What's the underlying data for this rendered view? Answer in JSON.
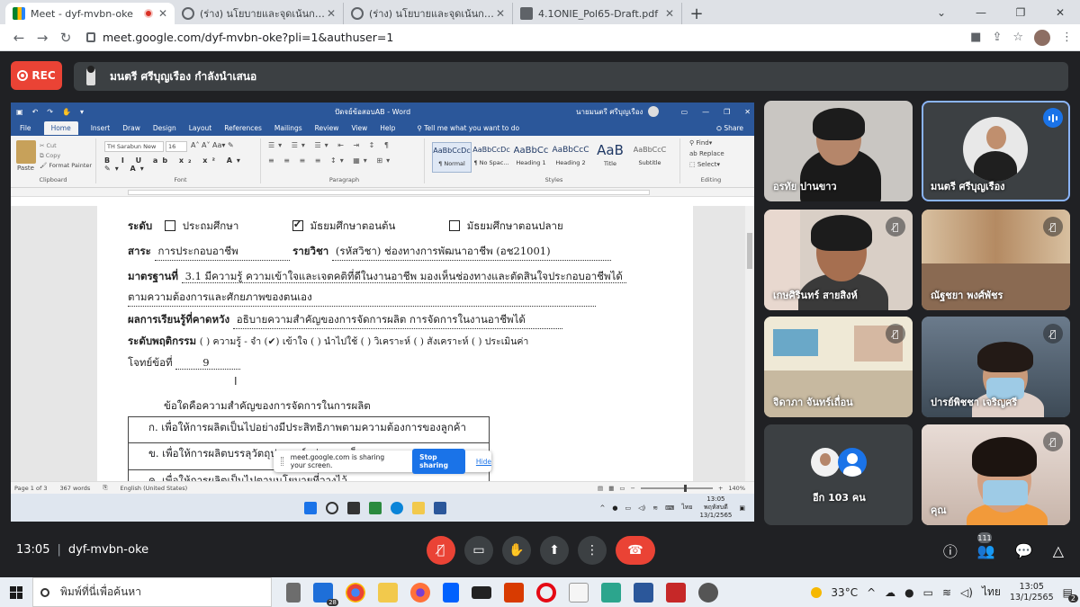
{
  "browser": {
    "tabs": [
      {
        "title": "Meet - dyf-mvbn-oke",
        "icon": "meet-icon",
        "active": true,
        "recording": true
      },
      {
        "title": "(ร่าง) นโยบายและจุดเน้นการดำเนินงาน",
        "icon": "globe-icon"
      },
      {
        "title": "(ร่าง) นโยบายและจุดเน้นการดำเนินงาน",
        "icon": "globe-icon"
      },
      {
        "title": "4.1ONIE_Pol65-Draft.pdf",
        "icon": "pdf-icon"
      }
    ],
    "url": "meet.google.com/dyf-mvbn-oke?pli=1&authuser=1"
  },
  "meet": {
    "rec_label": "REC",
    "presenting_text": "มนตรี ศรีบุญเรือง กำลังนำเสนอ",
    "time": "13:05",
    "meeting_code": "dyf-mvbn-oke",
    "people_count": "111",
    "colors": {
      "bg": "#202124",
      "tile": "#3c4043",
      "red": "#ea4335",
      "blue": "#1a73e8"
    }
  },
  "word": {
    "title": "ปัดจย์ข้อสอบAB - Word",
    "user": "นายมนตรี ศรีบุญเรือง",
    "menu": [
      "File",
      "Home",
      "Insert",
      "Draw",
      "Design",
      "Layout",
      "References",
      "Mailings",
      "Review",
      "View",
      "Help"
    ],
    "tell_me": "Tell me what you want to do",
    "share": "Share",
    "clipboard": {
      "paste": "Paste",
      "cut": "Cut",
      "copy": "Copy",
      "painter": "Format Painter",
      "label": "Clipboard"
    },
    "font": {
      "name": "TH Sarabun New",
      "size": "16",
      "label": "Font"
    },
    "paragraph_label": "Paragraph",
    "styles": [
      {
        "preview": "AaBbCcDc",
        "name": "¶ Normal"
      },
      {
        "preview": "AaBbCcDc",
        "name": "¶ No Spac..."
      },
      {
        "preview": "AaBbCc",
        "name": "Heading 1"
      },
      {
        "preview": "AaBbCcC",
        "name": "Heading 2"
      },
      {
        "preview": "AaB",
        "name": "Title"
      },
      {
        "preview": "AaBbCcC",
        "name": "Subtitle"
      }
    ],
    "styles_label": "Styles",
    "editing": {
      "find": "Find",
      "replace": "Replace",
      "select": "Select",
      "label": "Editing"
    },
    "status": {
      "page": "Page 1 of 3",
      "words": "367 words",
      "lang": "English (United States)",
      "zoom": "140%"
    },
    "toast": {
      "text": "meet.google.com is sharing your screen.",
      "stop": "Stop sharing",
      "hide": "Hide"
    },
    "taskbar_time": "13:05",
    "taskbar_day": "พฤหัสบดี",
    "taskbar_date": "13/1/2565",
    "taskbar_lang": "ไทย"
  },
  "doc": {
    "level_label": "ระดับ",
    "level_options": [
      {
        "label": "ประถมศึกษา",
        "checked": false
      },
      {
        "label": "มัธยมศึกษาตอนต้น",
        "checked": true
      },
      {
        "label": "มัธยมศึกษาตอนปลาย",
        "checked": false
      }
    ],
    "strand_label": "สาระ",
    "strand_value": "การประกอบอาชีพ",
    "subject_label": "รายวิชา",
    "subject_value": "(รหัสวิชา)  ช่องทางการพัฒนาอาชีพ (อช21001)",
    "standard_label": "มาตรฐานที่",
    "standard_value": "3.1 มีความรู้ ความเข้าใจและเจตคติที่ดีในงานอาชีพ มองเห็นช่องทางและตัดสินใจประกอบอาชีพได้",
    "standard_value2": "ตามความต้องการและศักยภาพของตนเอง",
    "outcome_label": "ผลการเรียนรู้ที่คาดหวัง",
    "outcome_value": "อธิบายความสำคัญของการจัดการผลิต การจัดการในงานอาชีพได้",
    "behavior_label": "ระดับพฤติกรรม",
    "behavior_value": "(   ) ความรู้ - จำ  (✔) เข้าใจ    (   ) นำไปใช้    (   ) วิเคราะห์  (   ) สังเคราะห์ (   ) ประเมินค่า",
    "item_label": "โจทย์ข้อที่",
    "item_value": "9",
    "question": "ข้อใดคือความสำคัญของการจัดการในการผลิต",
    "choices": [
      "ก. เพื่อให้การผลิตเป็นไปอย่างมีประสิทธิภาพตามความต้องการของลูกค้า",
      "ข. เพื่อให้การผลิตบรรลุวัตถุประสงค์อย่างรวดเร็ว",
      "ค. เพื่อให้การผลิตเป็นไปตามนโยบายที่วางไว้"
    ]
  },
  "participants": [
    {
      "name": "อรทัย ปานขาว"
    },
    {
      "name": "มนตรี ศรีบุญเรือง",
      "speaking": true
    },
    {
      "name": "เกษศิรินทร์ สายสิงห์",
      "muted": true
    },
    {
      "name": "ณัฐชยา พงศ์พัชร",
      "muted": true
    },
    {
      "name": "จิดาภา จันทร์เถื่อน",
      "muted": true
    },
    {
      "name": "ปารย์พิชชา เจริญศรี",
      "muted": true
    },
    {
      "name": "อีก 103 คน"
    },
    {
      "name": "คุณ",
      "muted": true
    }
  ],
  "taskbar": {
    "search_placeholder": "พิมพ์ที่นี่เพื่อค้นหา",
    "mail_count": "28",
    "weather": "33°C",
    "lang": "ไทย",
    "time": "13:05",
    "date": "13/1/2565",
    "notif_count": "2"
  }
}
